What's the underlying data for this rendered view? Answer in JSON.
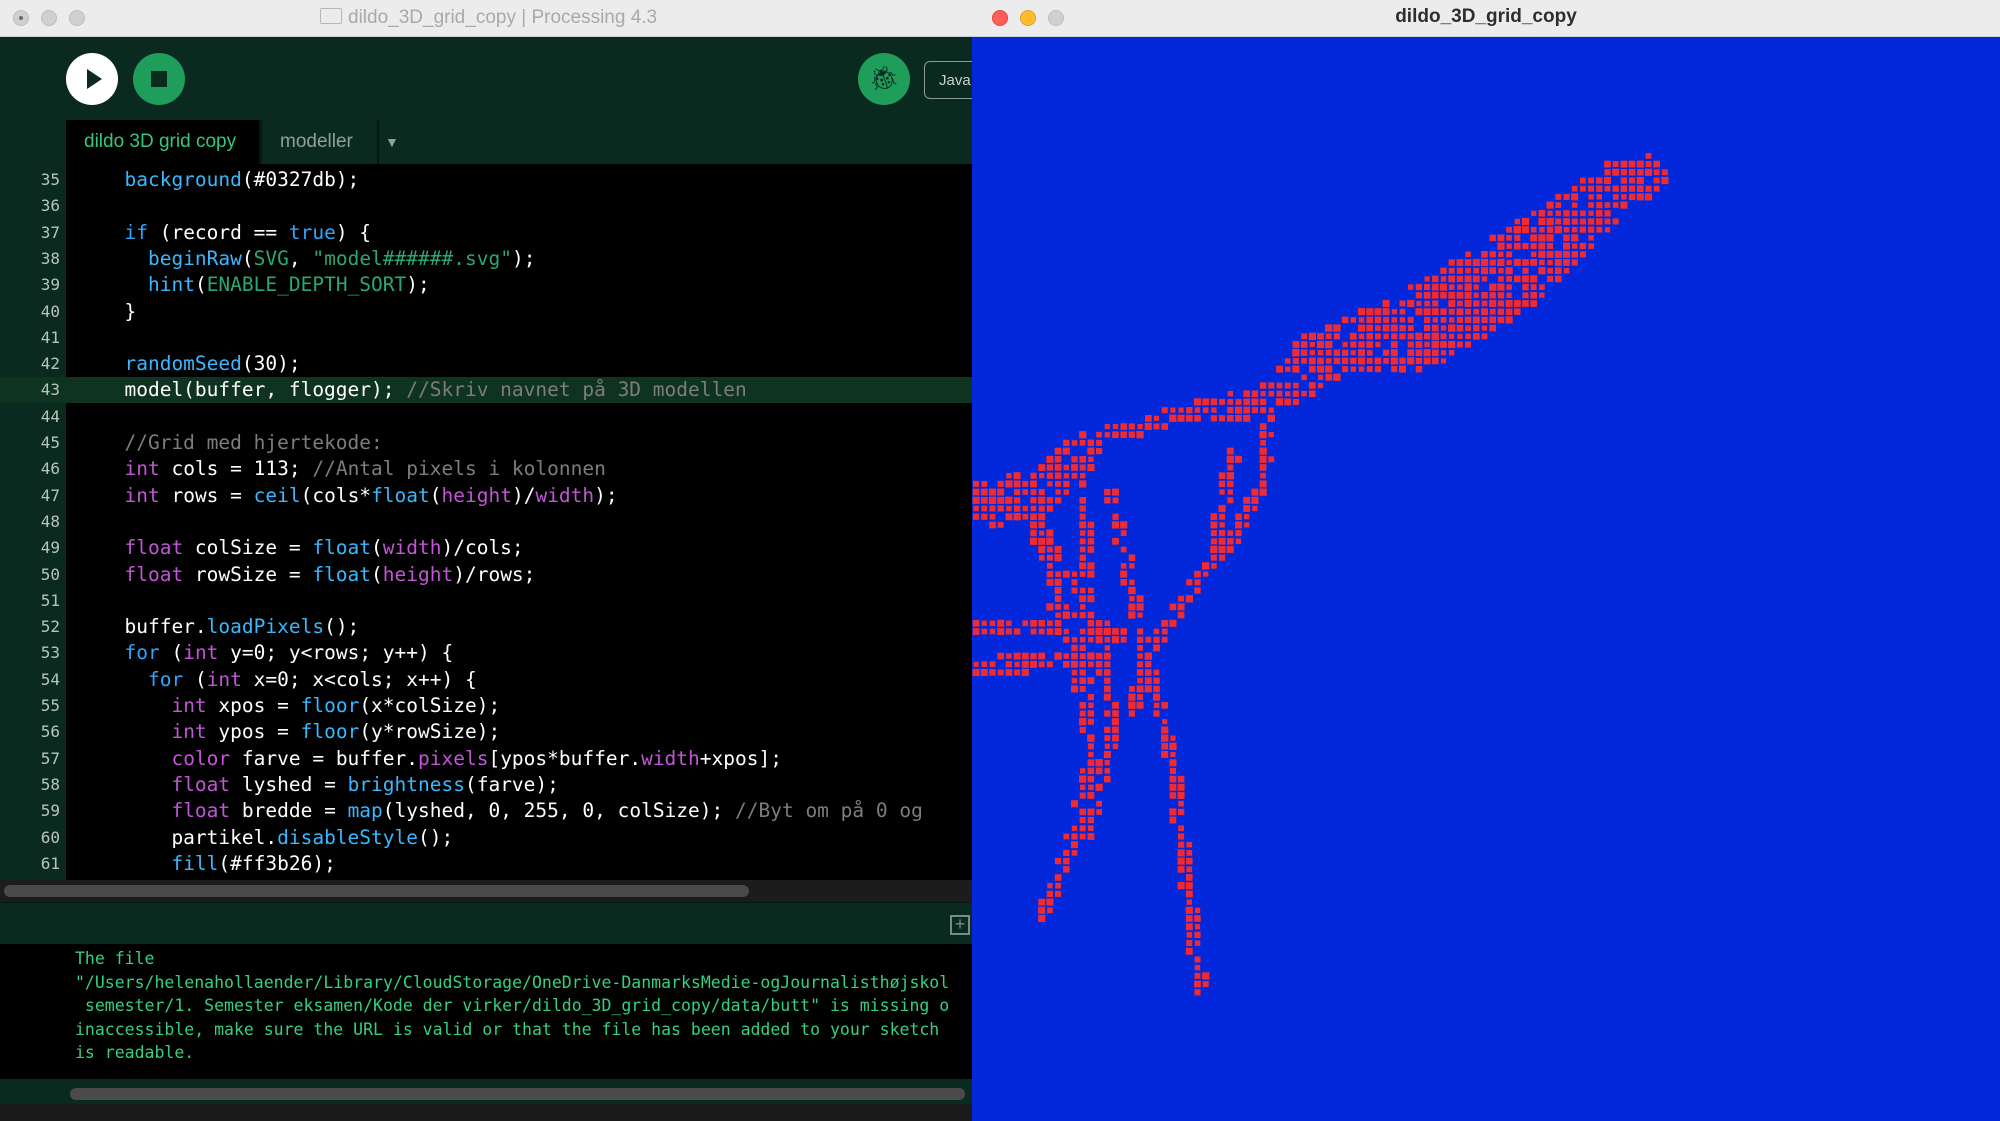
{
  "ide": {
    "window_title": "dildo_3D_grid_copy | Processing 4.3",
    "mode_label": "Java",
    "debug_icon": "bug-icon",
    "tabs": [
      {
        "label": "dildo 3D grid copy"
      },
      {
        "label": "modeller"
      }
    ],
    "tab_menu_icon": "▼",
    "current_line": 43,
    "code_lines": [
      {
        "num": "35",
        "tokens": [
          [
            "  ",
            "n"
          ],
          [
            "background",
            "f"
          ],
          [
            "(#0327db);",
            "n"
          ]
        ]
      },
      {
        "num": "36",
        "tokens": []
      },
      {
        "num": "37",
        "tokens": [
          [
            "  ",
            "n"
          ],
          [
            "if",
            "k"
          ],
          [
            " (record == ",
            "n"
          ],
          [
            "true",
            "k"
          ],
          [
            ") {",
            "n"
          ]
        ]
      },
      {
        "num": "38",
        "tokens": [
          [
            "    ",
            "n"
          ],
          [
            "beginRaw",
            "f"
          ],
          [
            "(",
            "n"
          ],
          [
            "SVG",
            "s"
          ],
          [
            ", ",
            "n"
          ],
          [
            "\"model######.svg\"",
            "s"
          ],
          [
            ");",
            "n"
          ]
        ]
      },
      {
        "num": "39",
        "tokens": [
          [
            "    ",
            "n"
          ],
          [
            "hint",
            "f"
          ],
          [
            "(",
            "n"
          ],
          [
            "ENABLE_DEPTH_SORT",
            "s"
          ],
          [
            ");",
            "n"
          ]
        ]
      },
      {
        "num": "40",
        "tokens": [
          [
            "  }",
            "n"
          ]
        ]
      },
      {
        "num": "41",
        "tokens": []
      },
      {
        "num": "42",
        "tokens": [
          [
            "  ",
            "n"
          ],
          [
            "randomSeed",
            "f"
          ],
          [
            "(30);",
            "n"
          ]
        ]
      },
      {
        "num": "43",
        "tokens": [
          [
            "  model(buffer, flogger); ",
            "n"
          ],
          [
            "//Skriv navnet på 3D modellen",
            "c"
          ]
        ]
      },
      {
        "num": "44",
        "tokens": []
      },
      {
        "num": "45",
        "tokens": [
          [
            "  ",
            "n"
          ],
          [
            "//Grid med hjertekode:",
            "c"
          ]
        ]
      },
      {
        "num": "46",
        "tokens": [
          [
            "  ",
            "n"
          ],
          [
            "int",
            "v"
          ],
          [
            " cols = 113; ",
            "n"
          ],
          [
            "//Antal pixels i kolonnen",
            "c"
          ]
        ]
      },
      {
        "num": "47",
        "tokens": [
          [
            "  ",
            "n"
          ],
          [
            "int",
            "v"
          ],
          [
            " rows = ",
            "n"
          ],
          [
            "ceil",
            "f"
          ],
          [
            "(cols*",
            "n"
          ],
          [
            "float",
            "f"
          ],
          [
            "(",
            "n"
          ],
          [
            "height",
            "v"
          ],
          [
            ")/",
            "n"
          ],
          [
            "width",
            "v"
          ],
          [
            ");",
            "n"
          ]
        ]
      },
      {
        "num": "48",
        "tokens": []
      },
      {
        "num": "49",
        "tokens": [
          [
            "  ",
            "n"
          ],
          [
            "float",
            "v"
          ],
          [
            " colSize = ",
            "n"
          ],
          [
            "float",
            "f"
          ],
          [
            "(",
            "n"
          ],
          [
            "width",
            "v"
          ],
          [
            ")/cols;",
            "n"
          ]
        ]
      },
      {
        "num": "50",
        "tokens": [
          [
            "  ",
            "n"
          ],
          [
            "float",
            "v"
          ],
          [
            " rowSize = ",
            "n"
          ],
          [
            "float",
            "f"
          ],
          [
            "(",
            "n"
          ],
          [
            "height",
            "v"
          ],
          [
            ")/rows;",
            "n"
          ]
        ]
      },
      {
        "num": "51",
        "tokens": []
      },
      {
        "num": "52",
        "tokens": [
          [
            "  buffer.",
            "n"
          ],
          [
            "loadPixels",
            "f"
          ],
          [
            "();",
            "n"
          ]
        ]
      },
      {
        "num": "53",
        "tokens": [
          [
            "  ",
            "n"
          ],
          [
            "for",
            "k"
          ],
          [
            " (",
            "n"
          ],
          [
            "int",
            "v"
          ],
          [
            " y=0; y<rows; y++) {",
            "n"
          ]
        ]
      },
      {
        "num": "54",
        "tokens": [
          [
            "    ",
            "n"
          ],
          [
            "for",
            "k"
          ],
          [
            " (",
            "n"
          ],
          [
            "int",
            "v"
          ],
          [
            " x=0; x<cols; x++) {",
            "n"
          ]
        ]
      },
      {
        "num": "55",
        "tokens": [
          [
            "      ",
            "n"
          ],
          [
            "int",
            "v"
          ],
          [
            " xpos = ",
            "n"
          ],
          [
            "floor",
            "f"
          ],
          [
            "(x*colSize);",
            "n"
          ]
        ]
      },
      {
        "num": "56",
        "tokens": [
          [
            "      ",
            "n"
          ],
          [
            "int",
            "v"
          ],
          [
            " ypos = ",
            "n"
          ],
          [
            "floor",
            "f"
          ],
          [
            "(y*rowSize);",
            "n"
          ]
        ]
      },
      {
        "num": "57",
        "tokens": [
          [
            "      ",
            "n"
          ],
          [
            "color",
            "v"
          ],
          [
            " farve = buffer.",
            "n"
          ],
          [
            "pixels",
            "v"
          ],
          [
            "[ypos*buffer.",
            "n"
          ],
          [
            "width",
            "v"
          ],
          [
            "+xpos];",
            "n"
          ]
        ]
      },
      {
        "num": "58",
        "tokens": [
          [
            "      ",
            "n"
          ],
          [
            "float",
            "v"
          ],
          [
            " lyshed = ",
            "n"
          ],
          [
            "brightness",
            "f"
          ],
          [
            "(farve);",
            "n"
          ]
        ]
      },
      {
        "num": "59",
        "tokens": [
          [
            "      ",
            "n"
          ],
          [
            "float",
            "v"
          ],
          [
            " bredde = ",
            "n"
          ],
          [
            "map",
            "f"
          ],
          [
            "(lyshed, 0, 255, 0, colSize); ",
            "n"
          ],
          [
            "//Byt om på 0 og",
            "c"
          ]
        ]
      },
      {
        "num": "60",
        "tokens": [
          [
            "      partikel.",
            "n"
          ],
          [
            "disableStyle",
            "f"
          ],
          [
            "();",
            "n"
          ]
        ]
      },
      {
        "num": "61",
        "tokens": [
          [
            "      ",
            "n"
          ],
          [
            "fill",
            "f"
          ],
          [
            "(#ff3b26);",
            "n"
          ]
        ]
      }
    ],
    "console_lines": [
      "The file",
      "\"/Users/helenahollaender/Library/CloudStorage/OneDrive-DanmarksMedie-ogJournalisthøjskol",
      " semester/1. Semester eksamen/Kode der virker/dildo_3D_grid_copy/data/butt\" is missing o",
      "inaccessible, make sure the URL is valid or that the file has been added to your sketch",
      "is readable."
    ]
  },
  "sketch": {
    "window_title": "dildo_3D_grid_copy",
    "background_color": "#0327db",
    "particle_color": "#ee2a33"
  }
}
